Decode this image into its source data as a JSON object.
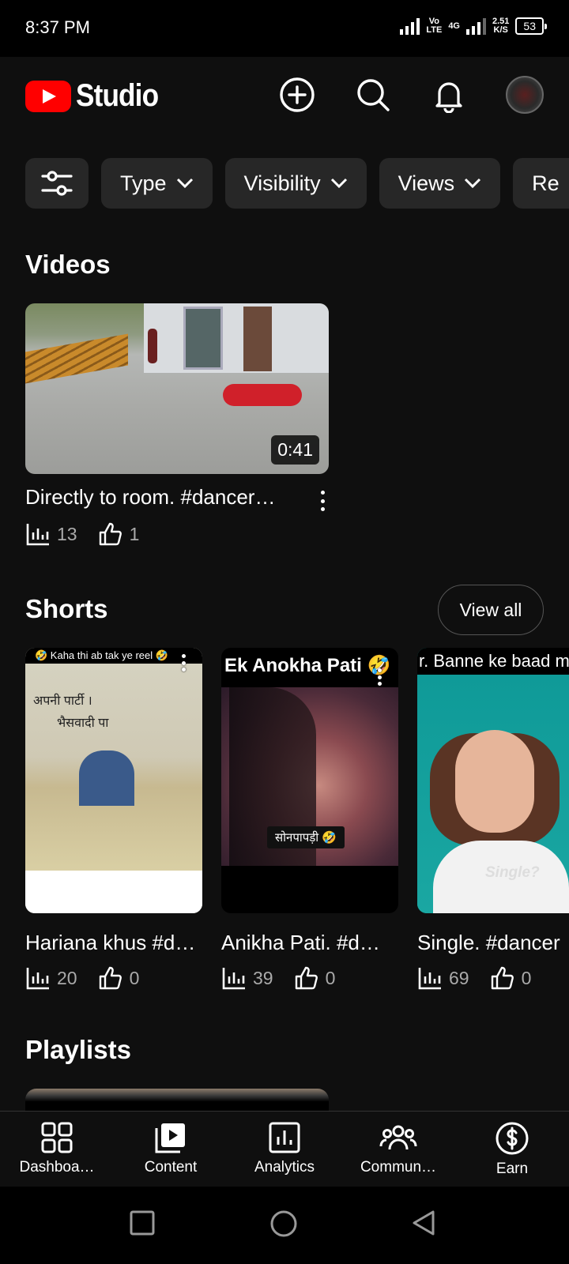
{
  "status_bar": {
    "time": "8:37 PM",
    "volte_top": "Vo",
    "volte_bottom": "LTE",
    "network": "4G",
    "speed_value": "2.51",
    "speed_unit": "K/S",
    "battery": "53"
  },
  "header": {
    "logo_text": "Studio"
  },
  "filters": [
    {
      "label": "Type"
    },
    {
      "label": "Visibility"
    },
    {
      "label": "Views"
    },
    {
      "label": "Re"
    }
  ],
  "videos": {
    "heading": "Videos",
    "items": [
      {
        "title": "Directly to room.  #dancer…",
        "duration": "0:41",
        "views": "13",
        "likes": "1"
      }
    ]
  },
  "shorts": {
    "heading": "Shorts",
    "view_all_label": "View all",
    "items": [
      {
        "title": "Hariana khus #d…",
        "views": "20",
        "likes": "0",
        "overlay_top": "🤣 Kaha thi ab tak ye reel 🤣",
        "overlay_text_1": "अपनी पार्टी ।",
        "overlay_text_2": "भैसवादी पा",
        "overlay_bottom": "😂😂😂😂😂😂😂😂"
      },
      {
        "title": "Anikha Pati. #d…",
        "views": "39",
        "likes": "0",
        "overlay_top": "Ek Anokha Pati 🤣",
        "overlay_sub": "सोनपापड़ी 🤣"
      },
      {
        "title": "Single. #dancer",
        "views": "69",
        "likes": "0",
        "overlay_top": "r. Banne ke baad mera",
        "overlay_sub": "Single?"
      }
    ]
  },
  "playlists": {
    "heading": "Playlists"
  },
  "bottom_nav": [
    {
      "label": "Dashboa…",
      "icon": "dashboard-icon"
    },
    {
      "label": "Content",
      "icon": "content-icon"
    },
    {
      "label": "Analytics",
      "icon": "analytics-icon"
    },
    {
      "label": "Commun…",
      "icon": "community-icon"
    },
    {
      "label": "Earn",
      "icon": "earn-icon"
    }
  ],
  "colors": {
    "background": "#0f0f0f",
    "chip": "#272727",
    "brand_red": "#ff0000",
    "secondary_text": "#aaaaaa"
  }
}
